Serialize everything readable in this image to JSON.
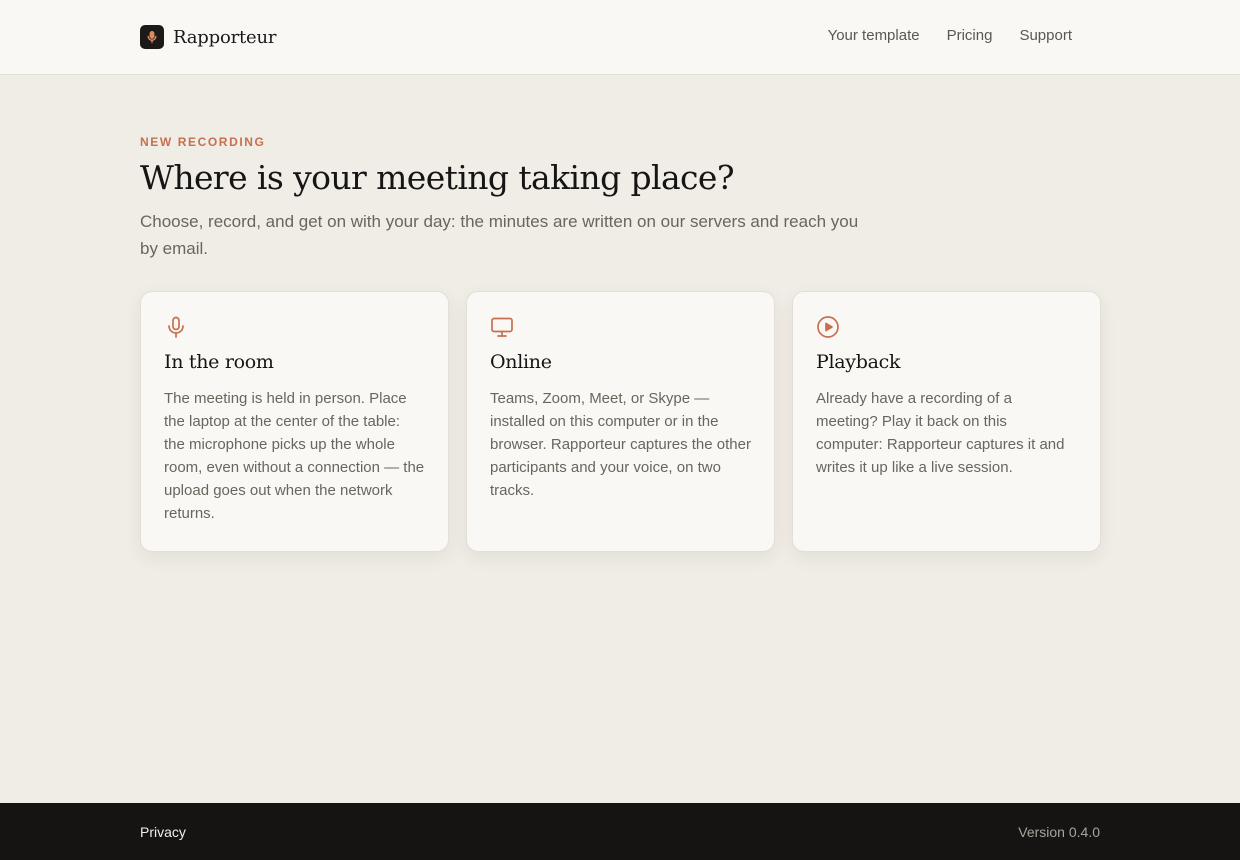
{
  "brand": {
    "name": "Rapporteur",
    "logo_icon": "microphone-icon"
  },
  "nav": {
    "items": [
      {
        "label": "Your template"
      },
      {
        "label": "Pricing"
      },
      {
        "label": "Support"
      }
    ]
  },
  "page": {
    "eyebrow": "NEW RECORDING",
    "title": "Where is your meeting taking place?",
    "subtitle": "Choose, record, and get on with your day: the minutes are written on our servers and reach you by email."
  },
  "cards": [
    {
      "icon": "microphone-icon",
      "title": "In the room",
      "body": "The meeting is held in person. Place the laptop at the center of the table: the microphone picks up the whole room, even without a connection — the upload goes out when the network returns."
    },
    {
      "icon": "monitor-icon",
      "title": "Online",
      "body": "Teams, Zoom, Meet, or Skype — installed on this computer or in the browser. Rapporteur captures the other participants and your voice, on two tracks."
    },
    {
      "icon": "play-circle-icon",
      "title": "Playback",
      "body": "Already have a recording of a meeting? Play it back on this computer: Rapporteur captures it and writes it up like a live session."
    }
  ],
  "footer": {
    "privacy_label": "Privacy",
    "version": "Version 0.4.0"
  },
  "colors": {
    "accent": "#c7704f",
    "background": "#f0ede6",
    "surface": "#f9f8f5",
    "footer": "#151413"
  }
}
